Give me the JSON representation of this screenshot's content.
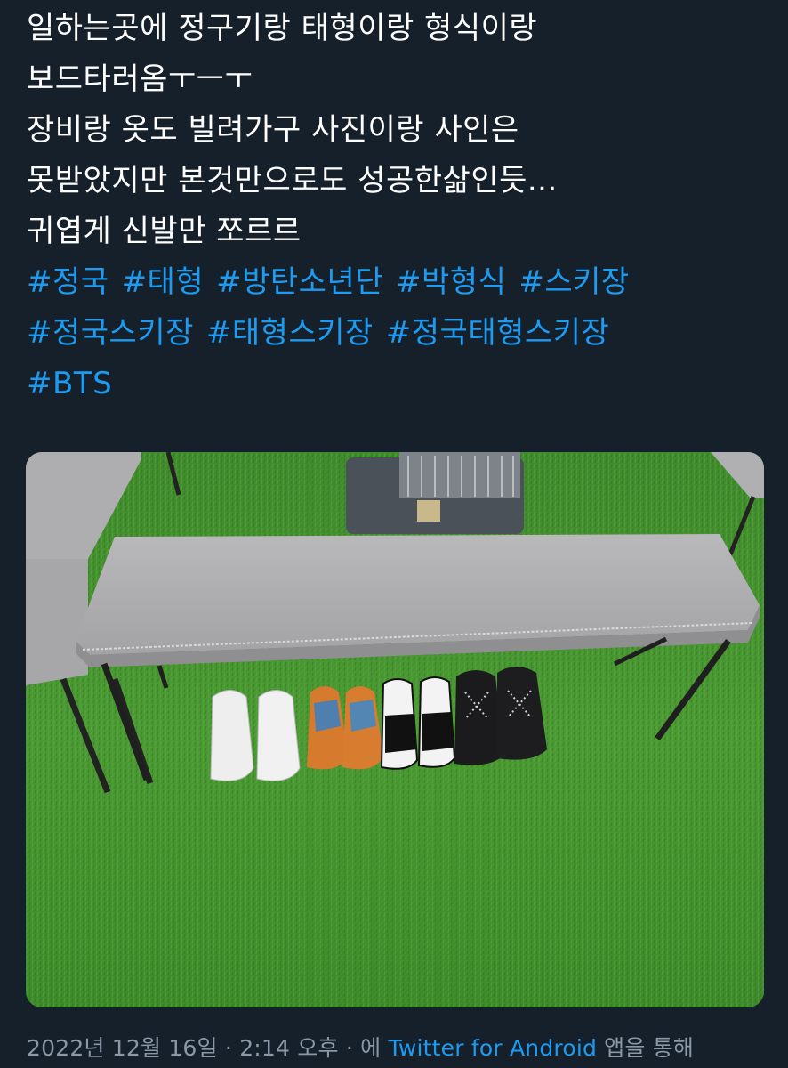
{
  "tweet": {
    "lines": [
      "일하는곳에 정구기랑 태형이랑 형식이랑",
      "보드타러옴ㅜㅡㅜ",
      "장비랑 옷도 빌려가구 사진이랑 사인은",
      "못받았지만 본것만으로도 성공한삶인듯...",
      "귀엽게 신발만 쪼르르"
    ],
    "hashtags": [
      "#정국",
      "#태형",
      "#방탄소년단",
      "#박형식",
      "#스키장",
      "#정국스키장",
      "#태형스키장",
      "#정국태형스키장",
      "#BTS"
    ]
  },
  "meta": {
    "date": "2022년 12월 16일",
    "sep1": " · ",
    "time": "2:14 오후",
    "sep2": " · ",
    "via": "에 ",
    "source": "Twitter for Android",
    "suffix": " 앱을 통해"
  },
  "colors": {
    "background": "#15202b",
    "link": "#1d9bf0",
    "text": "#ffffff",
    "muted": "#8b98a5"
  },
  "icons": [
    "photo-of-shoes-under-bench"
  ]
}
